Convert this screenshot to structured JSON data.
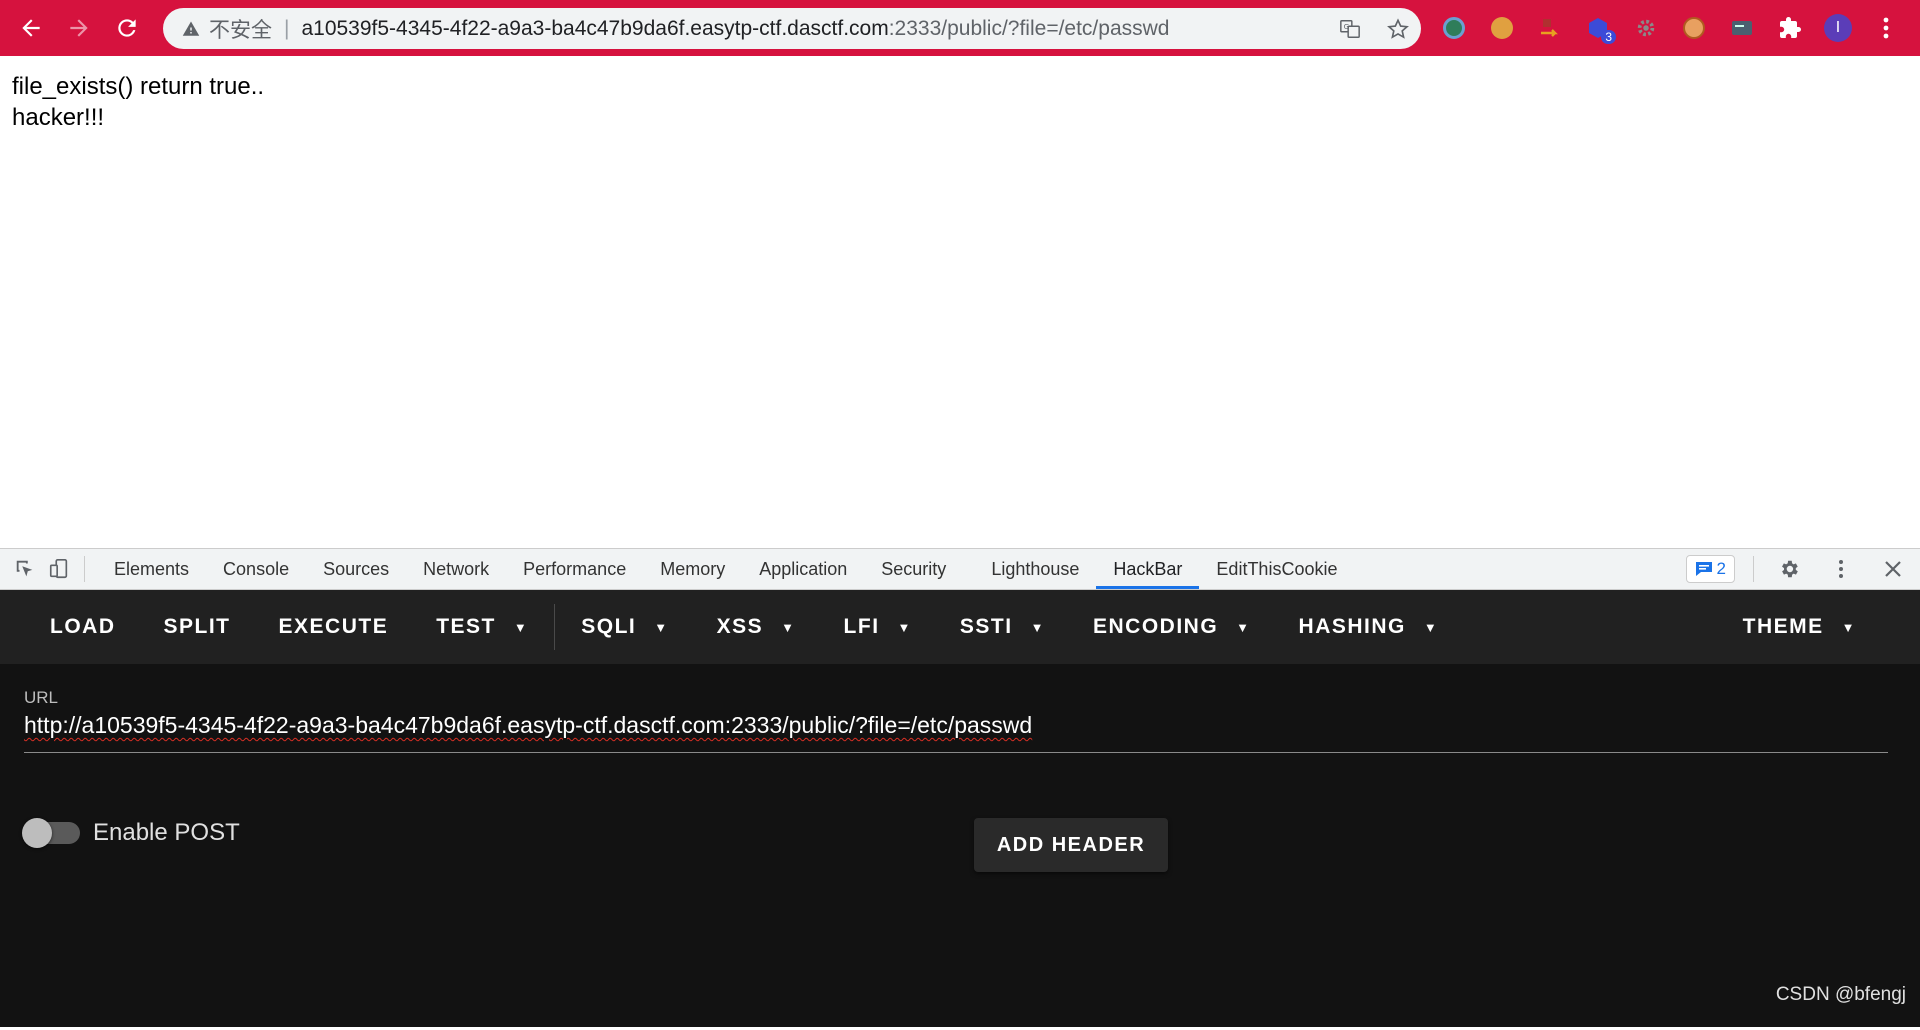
{
  "browser": {
    "omnibox": {
      "security_label": "不安全",
      "host": "a10539f5-4345-4f22-a9a3-ba4c47b9da6f.easytp-ctf.dasctf.com",
      "path": ":2333/public/?file=/etc/passwd"
    },
    "extensions": [
      {
        "name": "ext-globe-icon",
        "color": "#2f7d5a"
      },
      {
        "name": "ext-cookie-icon",
        "color": "#e0a040"
      },
      {
        "name": "ext-arrow-icon",
        "color": "#e86a1a"
      },
      {
        "name": "ext-cube-icon",
        "color": "#3c4bd8",
        "badge": "3"
      },
      {
        "name": "ext-gear-icon",
        "color": "#8a8a8a"
      },
      {
        "name": "ext-face-icon",
        "color": "#e8a060"
      },
      {
        "name": "ext-card-icon",
        "color": "#4a6070"
      }
    ],
    "avatar_letter": "I",
    "accent": "#d6123e"
  },
  "page": {
    "line1": "file_exists() return true..",
    "line2": "hacker!!!"
  },
  "devtools": {
    "tabs": [
      "Elements",
      "Console",
      "Sources",
      "Network",
      "Performance",
      "Memory",
      "Application",
      "Security",
      "Lighthouse",
      "HackBar",
      "EditThisCookie"
    ],
    "active_tab": "HackBar",
    "issues_count": "2"
  },
  "hackbar": {
    "menu": {
      "load": "LOAD",
      "split": "SPLIT",
      "execute": "EXECUTE",
      "test": "TEST",
      "sqli": "SQLI",
      "xss": "XSS",
      "lfi": "LFI",
      "ssti": "SSTI",
      "encoding": "ENCODING",
      "hashing": "HASHING",
      "theme": "THEME"
    },
    "url_label": "URL",
    "url_value": "http://a10539f5-4345-4f22-a9a3-ba4c47b9da6f.easytp-ctf.dasctf.com:2333/public/?file=/etc/passwd",
    "enable_post_label": "Enable POST",
    "enable_post": false,
    "add_header_label": "ADD HEADER"
  },
  "watermark": "CSDN @bfengj"
}
